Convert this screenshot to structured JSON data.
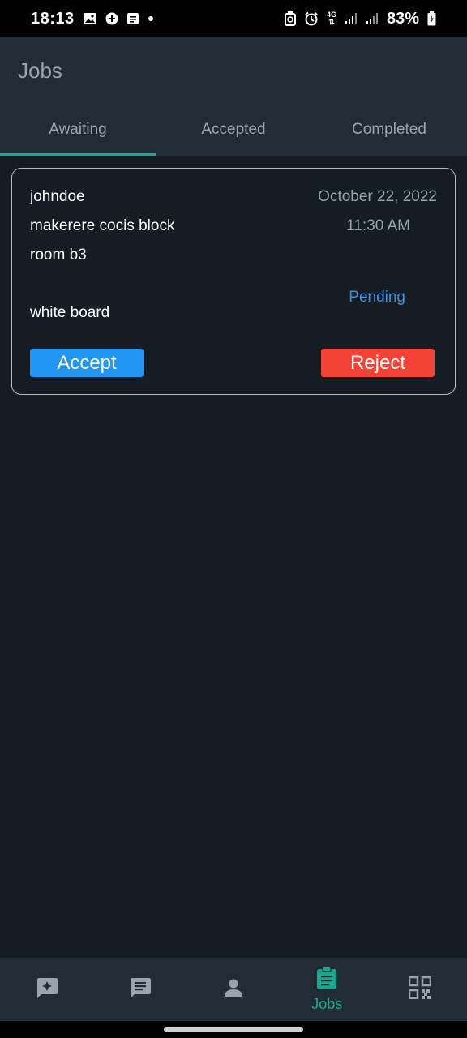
{
  "status_bar": {
    "time": "18:13",
    "network": "4G",
    "battery": "83%"
  },
  "header": {
    "title": "Jobs",
    "tabs": [
      {
        "label": "Awaiting",
        "active": true
      },
      {
        "label": "Accepted",
        "active": false
      },
      {
        "label": "Completed",
        "active": false
      }
    ]
  },
  "job": {
    "username": "johndoe",
    "date": "October 22, 2022",
    "location": "makerere cocis block",
    "time": "11:30 AM",
    "room": "room b3",
    "status": "Pending",
    "item": "white board",
    "accept_label": "Accept",
    "reject_label": "Reject"
  },
  "bottom_nav": {
    "items": [
      {
        "icon": "sparkle-chat-icon",
        "label": ""
      },
      {
        "icon": "message-icon",
        "label": ""
      },
      {
        "icon": "person-icon",
        "label": ""
      },
      {
        "icon": "clipboard-icon",
        "label": "Jobs",
        "active": true
      },
      {
        "icon": "qr-code-icon",
        "label": ""
      }
    ]
  },
  "colors": {
    "accent": "#16a991",
    "accept": "#2196f3",
    "reject": "#f44336",
    "status_pending": "#3b8fde",
    "background": "#151c23",
    "header": "#222c34"
  }
}
